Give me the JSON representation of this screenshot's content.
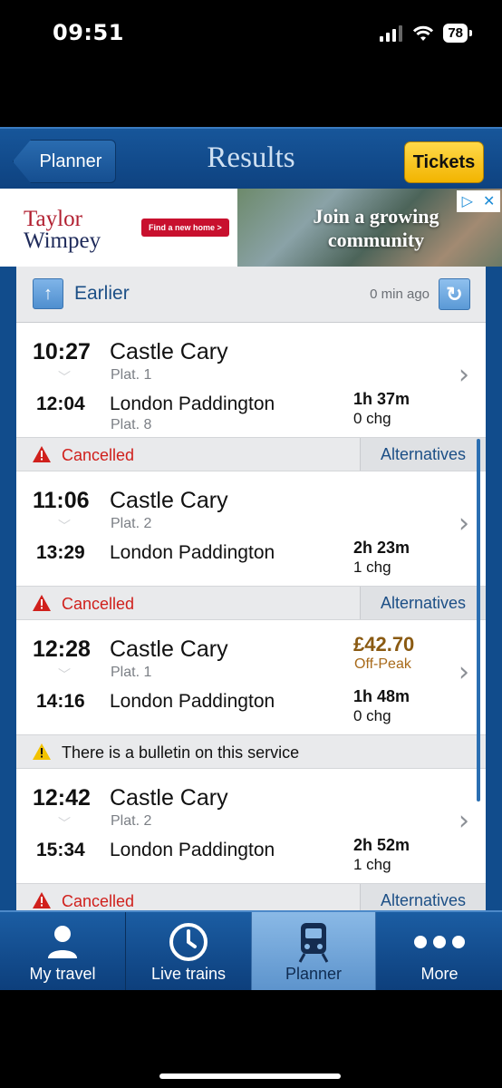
{
  "status_bar": {
    "time": "09:51",
    "battery": "78"
  },
  "nav": {
    "back_label": "Planner",
    "title": "Results",
    "tickets_label": "Tickets"
  },
  "ad": {
    "brand_line1": "Taylor",
    "brand_line2": "Wimpey",
    "cta": "Find a new home >",
    "tagline": "Join a growing community"
  },
  "earlier": {
    "label": "Earlier",
    "updated": "0 min ago"
  },
  "journeys": [
    {
      "dep_time": "10:27",
      "dep_station": "Castle Cary",
      "dep_plat": "Plat. 1",
      "arr_time": "12:04",
      "arr_station": "London Paddington",
      "arr_plat": "Plat. 8",
      "duration": "1h 37m",
      "changes": "0 chg",
      "price": "",
      "price_type": "",
      "status": "Cancelled",
      "status_type": "cancelled",
      "alt_label": "Alternatives"
    },
    {
      "dep_time": "11:06",
      "dep_station": "Castle Cary",
      "dep_plat": "Plat. 2",
      "arr_time": "13:29",
      "arr_station": "London Paddington",
      "arr_plat": "",
      "duration": "2h 23m",
      "changes": "1 chg",
      "price": "",
      "price_type": "",
      "status": "Cancelled",
      "status_type": "cancelled",
      "alt_label": "Alternatives"
    },
    {
      "dep_time": "12:28",
      "dep_station": "Castle Cary",
      "dep_plat": "Plat. 1",
      "arr_time": "14:16",
      "arr_station": "London Paddington",
      "arr_plat": "",
      "duration": "1h 48m",
      "changes": "0 chg",
      "price": "£42.70",
      "price_type": "Off-Peak",
      "status": "There is a bulletin on this service",
      "status_type": "bulletin",
      "alt_label": ""
    },
    {
      "dep_time": "12:42",
      "dep_station": "Castle Cary",
      "dep_plat": "Plat. 2",
      "arr_time": "15:34",
      "arr_station": "London Paddington",
      "arr_plat": "",
      "duration": "2h 52m",
      "changes": "1 chg",
      "price": "",
      "price_type": "",
      "status": "Cancelled",
      "status_type": "cancelled",
      "alt_label": "Alternatives"
    }
  ],
  "tabs": [
    {
      "label": "My travel",
      "icon": "person-icon"
    },
    {
      "label": "Live trains",
      "icon": "clock-icon"
    },
    {
      "label": "Planner",
      "icon": "train-icon",
      "selected": true
    },
    {
      "label": "More",
      "icon": "more-dots-icon"
    }
  ],
  "colors": {
    "brand_blue": "#114c8c",
    "tickets_yellow": "#f2b400",
    "cancel_red": "#d0201c",
    "price_brown": "#8a5a12"
  }
}
